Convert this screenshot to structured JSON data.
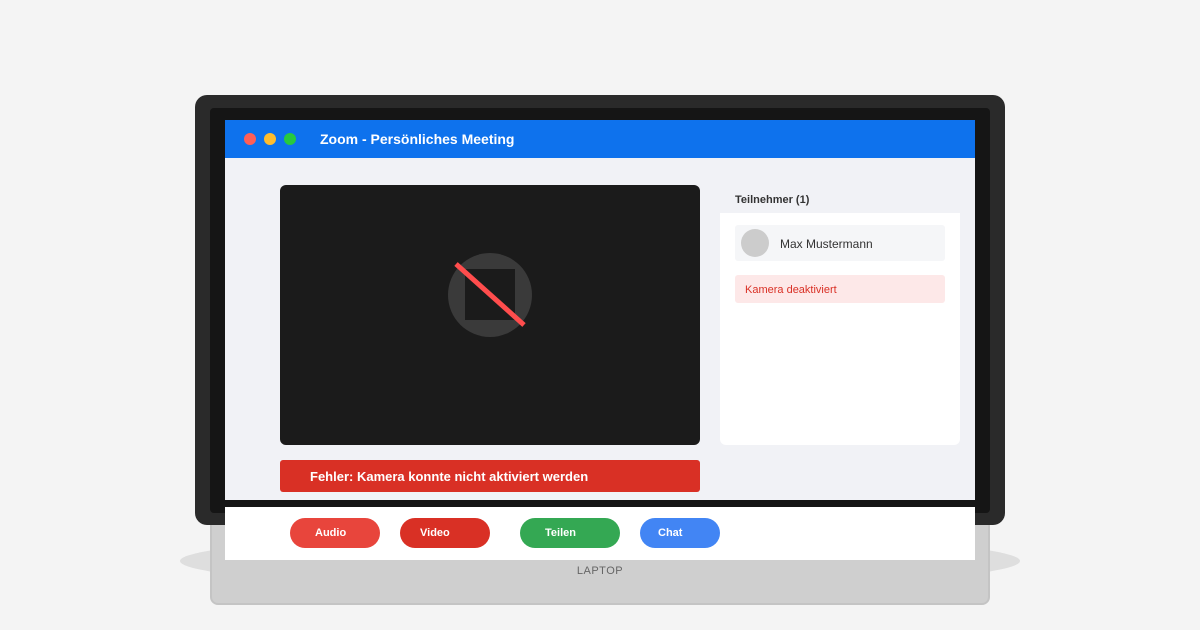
{
  "window": {
    "title": "Zoom - Persönliches Meeting"
  },
  "video": {
    "camera_state_icon": "camera-off-icon",
    "error_message": "Fehler: Kamera konnte nicht aktiviert werden"
  },
  "participants": {
    "heading": "Teilnehmer (1)",
    "items": [
      {
        "name": "Max Mustermann",
        "avatar_icon": "avatar-placeholder"
      }
    ],
    "notice": "Kamera deaktiviert"
  },
  "toolbar": {
    "audio_label": "Audio",
    "video_label": "Video",
    "share_label": "Teilen",
    "chat_label": "Chat"
  },
  "device": {
    "label": "LAPTOP"
  },
  "colors": {
    "accent": "#0e72ed",
    "error": "#d93025",
    "share": "#34a853",
    "chat": "#4285f4"
  }
}
